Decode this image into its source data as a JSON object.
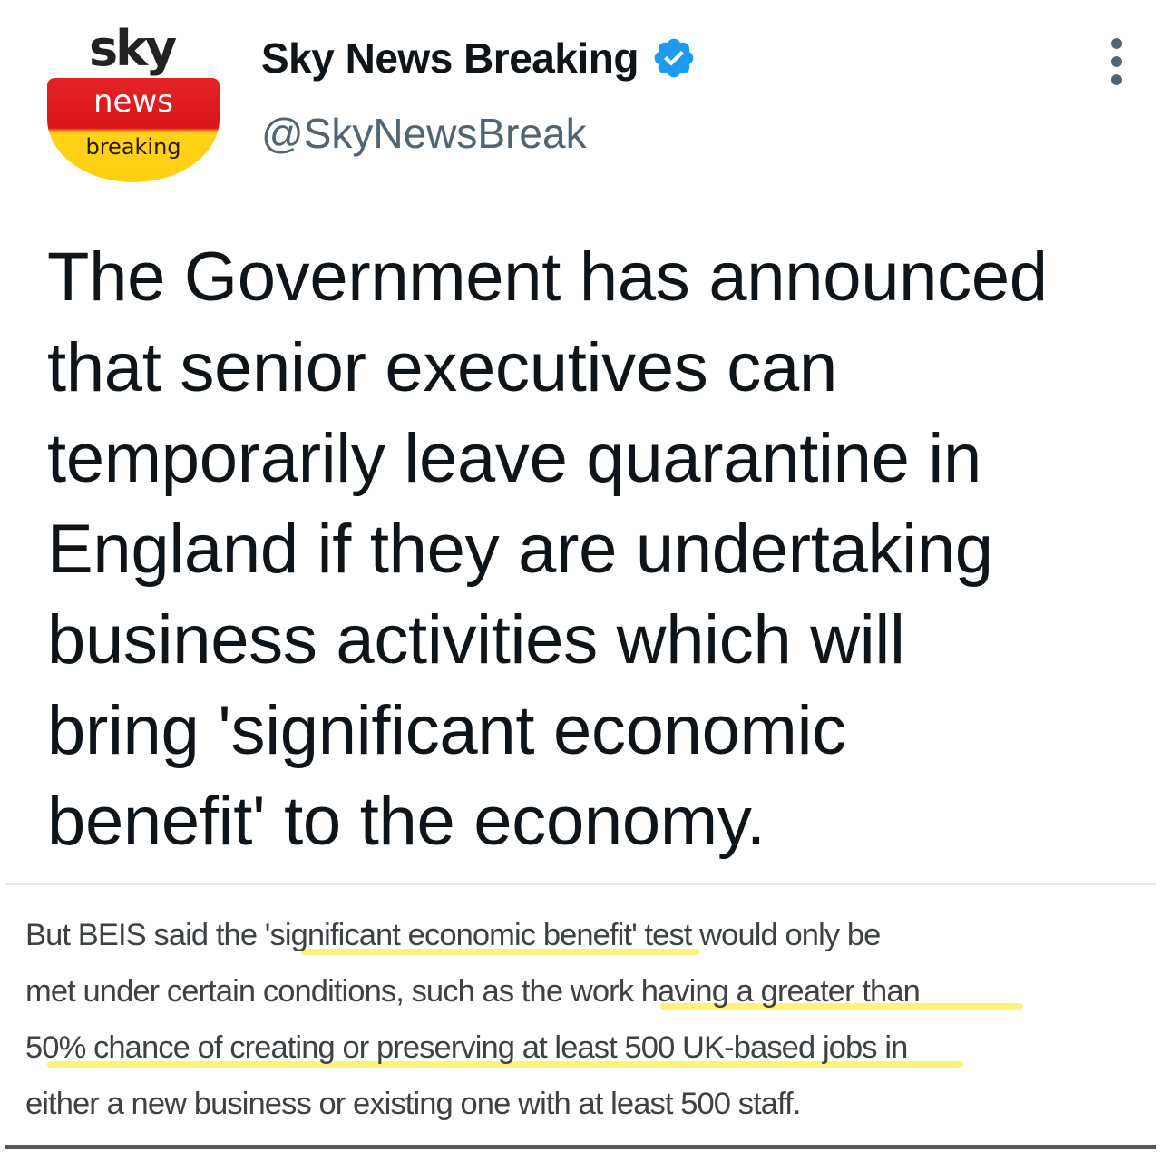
{
  "account": {
    "logo_top": "sky",
    "logo_middle": "news",
    "logo_bottom": "breaking",
    "display_name": "Sky News Breaking",
    "handle": "@SkyNewsBreak",
    "verified_icon": "verified-badge-icon",
    "more_icon": "more-options-icon"
  },
  "tweet": {
    "lines": [
      "The Government has announced",
      "that senior executives can",
      "temporarily leave quarantine in",
      "England if they are undertaking",
      "business activities which will",
      "bring 'significant economic",
      "benefit' to the economy."
    ]
  },
  "excerpt": {
    "lines": [
      "But BEIS said the 'significant economic benefit' test would only be",
      "met under certain conditions, such as the work having a greater than",
      "50% chance of creating or preserving at least 500 UK-based jobs in",
      "either a new business or existing one with at least 500 staff."
    ],
    "highlight_color": "#fff27a"
  },
  "colors": {
    "text_primary": "#0f1419",
    "text_secondary": "#536471",
    "verified_blue": "#1d9bf0",
    "excerpt_text": "#3f4044"
  }
}
